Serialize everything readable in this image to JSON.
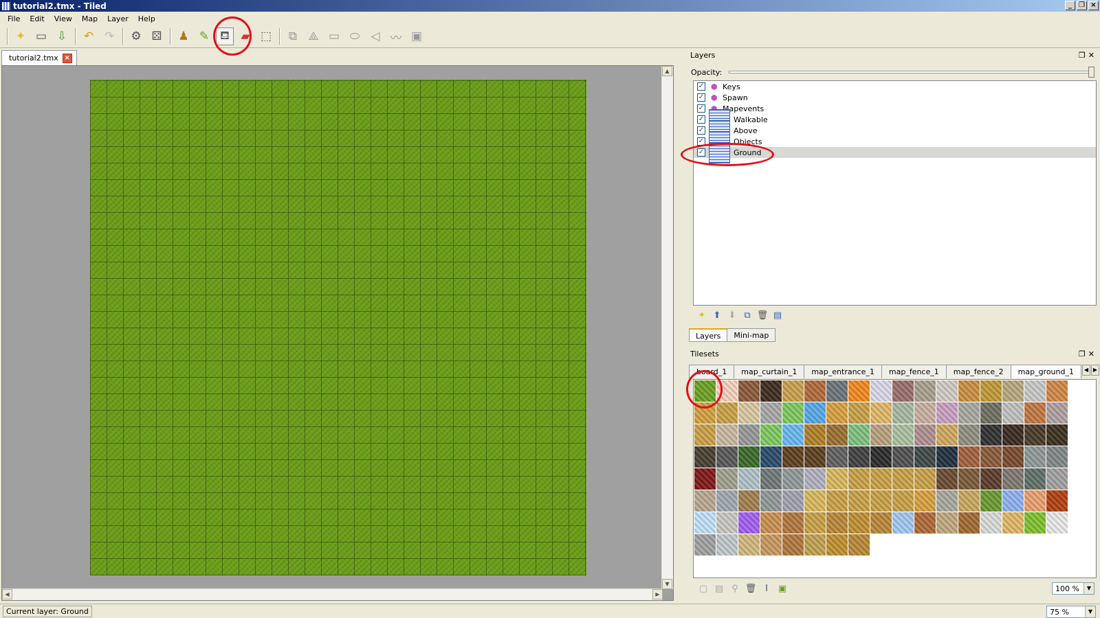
{
  "window": {
    "title": "tutorial2.tmx - Tiled",
    "btn_min": "_",
    "btn_max": "❐",
    "btn_close": "×"
  },
  "menu": [
    "File",
    "Edit",
    "View",
    "Map",
    "Layer",
    "Help"
  ],
  "toolbar": {
    "icons": [
      "new-icon",
      "open-icon",
      "save-icon",
      "undo-icon",
      "redo-icon",
      "commands-icon",
      "random-icon",
      "stamp-brush-icon",
      "terrain-brush-icon",
      "bucket-fill-icon",
      "eraser-icon",
      "rect-select-icon",
      "select-objects-icon",
      "edit-polygon-icon",
      "insert-rectangle-icon",
      "insert-ellipse-icon",
      "insert-polygon-icon",
      "insert-polyline-icon",
      "insert-tile-icon"
    ],
    "selected": "bucket-fill-icon"
  },
  "document": {
    "tab_label": "tutorial2.tmx",
    "close_glyph": "×"
  },
  "layers_panel": {
    "title": "Layers",
    "opacity_label": "Opacity:",
    "opacity": 1.0,
    "layers": [
      {
        "name": "Keys",
        "type": "object",
        "visible": true
      },
      {
        "name": "Spawn",
        "type": "object",
        "visible": true
      },
      {
        "name": "Mapevents",
        "type": "object",
        "visible": true
      },
      {
        "name": "Walkable",
        "type": "tile",
        "visible": true
      },
      {
        "name": "Above",
        "type": "tile",
        "visible": true
      },
      {
        "name": "Objects",
        "type": "tile",
        "visible": true
      },
      {
        "name": "Ground",
        "type": "tile",
        "visible": true,
        "selected": true
      }
    ],
    "tabs": [
      "Layers",
      "Mini-map"
    ],
    "active_tab": "Layers"
  },
  "tilesets_panel": {
    "title": "Tilesets",
    "tabs": [
      "board_1",
      "map_curtain_1",
      "map_entrance_1",
      "map_fence_1",
      "map_fence_2",
      "map_ground_1"
    ],
    "active_tab": "map_ground_1",
    "zoom": "100 %"
  },
  "tile_colors": [
    "#6aa022",
    "#f3d2bc",
    "#8c5a3a",
    "#3e2a1c",
    "#c8a050",
    "#b06a3a",
    "#6a7478",
    "#f08a20",
    "#d8d8e8",
    "#9a6e6a",
    "#a8a090",
    "#d0ccc4",
    "#c89040",
    "#c09a38",
    "#b8a880",
    "#c8c8c8",
    "#d08848",
    "#d0a040",
    "#c8a048",
    "#d8c8a0",
    "#a8a8a8",
    "#80c860",
    "#58a8e8",
    "#d8a040",
    "#c8a048",
    "#e0b868",
    "#a8b8a0",
    "#c8b0a0",
    "#c8a0c0",
    "#a8a8a0",
    "#707060",
    "#c0c0c0",
    "#c07840",
    "#b0a0a0",
    "#c8a048",
    "#c8b8a0",
    "#989898",
    "#80c860",
    "#68b8f0",
    "#b08028",
    "#9a7030",
    "#80c080",
    "#b8a080",
    "#a8c0a0",
    "#b09090",
    "#d0a860",
    "#909080",
    "#303030",
    "#3a2a20",
    "#4a3a28",
    "#3a3020",
    "#484030",
    "#585858",
    "#3a6a2a",
    "#2a4a6a",
    "#604020",
    "#5a4020",
    "#606060",
    "#404040",
    "#2a2a2a",
    "#505050",
    "#404848",
    "#203040",
    "#a06040",
    "#8a5a3a",
    "#7a4a30",
    "#909898",
    "#808888",
    "#801818",
    "#a0a090",
    "#b0c0c8",
    "#707878",
    "#909898",
    "#b0b0c0",
    "#d8b860",
    "#c8a048",
    "#c8a048",
    "#c8a048",
    "#c8a048",
    "#6a4a30",
    "#7a5a3a",
    "#5a3a28",
    "#807870",
    "#607068",
    "#a0a0a0",
    "#b8a890",
    "#a0a8b0",
    "#a08050",
    "#909898",
    "#a0a0b0",
    "#d8b860",
    "#c8a048",
    "#c8a048",
    "#c8a048",
    "#c8a048",
    "#d8a040",
    "#a8a8a0",
    "#c8a860",
    "#6a9a30",
    "#90b0f0",
    "#e8a070",
    "#b04010",
    "#c0e0f8",
    "#c8c8c0",
    "#a060f0",
    "#c89050",
    "#b07840",
    "#c8a048",
    "#b88838",
    "#c09030",
    "#b88838",
    "#a0c8f0",
    "#b06838",
    "#c0a880",
    "#a06a30",
    "#d8dcd8",
    "#e0b868",
    "#80c030",
    "#e8e8e8",
    "#a0a0a0",
    "#c0c8cc",
    "#d0b880",
    "#c89860",
    "#b07840",
    "#c0a050",
    "#c09030",
    "#b88838"
  ],
  "status": {
    "current_layer": "Current layer: Ground",
    "zoom": "75 %"
  }
}
